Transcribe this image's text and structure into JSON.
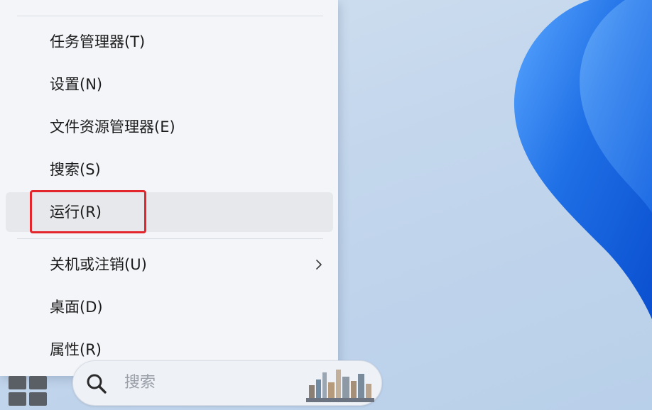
{
  "context_menu": {
    "items": [
      {
        "label": "任务管理器(T)",
        "has_submenu": false
      },
      {
        "label": "设置(N)",
        "has_submenu": false
      },
      {
        "label": "文件资源管理器(E)",
        "has_submenu": false
      },
      {
        "label": "搜索(S)",
        "has_submenu": false
      },
      {
        "label": "运行(R)",
        "has_submenu": false,
        "hovered": true,
        "highlighted": true
      },
      {
        "label": "关机或注销(U)",
        "has_submenu": true
      },
      {
        "label": "桌面(D)",
        "has_submenu": false
      },
      {
        "label": "属性(R)",
        "has_submenu": false
      }
    ]
  },
  "taskbar": {
    "search_placeholder": "搜索"
  },
  "icons": {
    "start": "windows-start-icon",
    "search": "search-icon",
    "submenu": "chevron-right-icon",
    "search_highlight": "city-skyline-icon"
  },
  "colors": {
    "menu_background": "#f3f5f9",
    "hover_background": "#e6e8ec",
    "highlight_border": "#e3262c",
    "wallpaper_bloom": "#1f6fe6",
    "start_icon": "#5a5f66"
  }
}
